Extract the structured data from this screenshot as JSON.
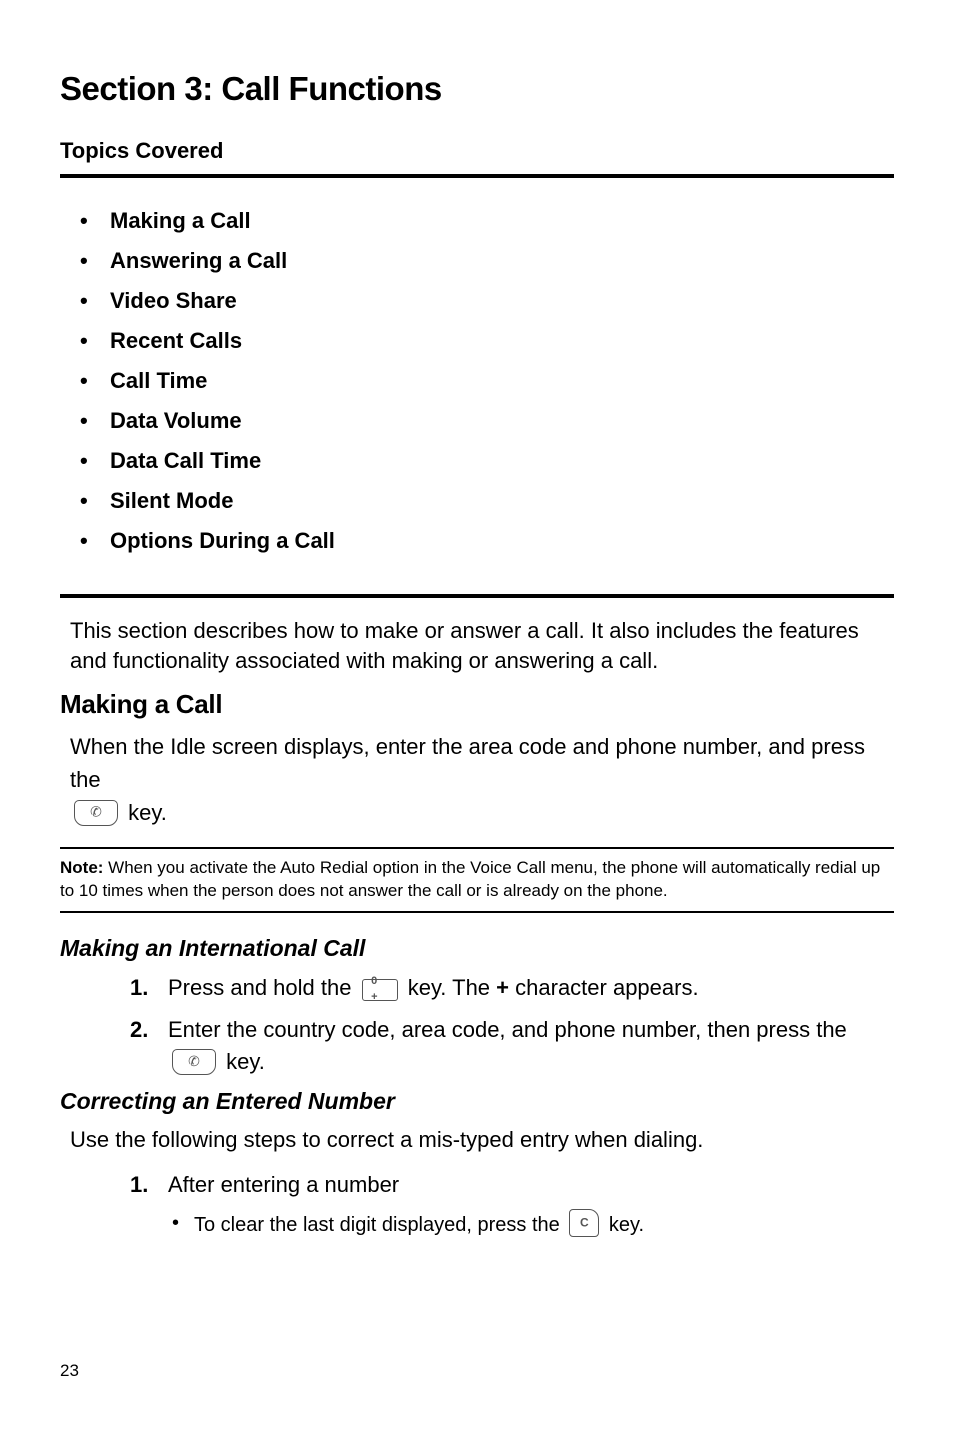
{
  "section_title": "Section 3:  Call Functions",
  "topics_header": "Topics Covered",
  "topics": [
    "Making a Call",
    "Answering a Call",
    "Video Share",
    "Recent Calls",
    "Call Time",
    "Data Volume",
    "Data Call Time",
    "Silent Mode",
    "Options During a Call"
  ],
  "intro_para": "This section describes how to make or answer a call. It also includes the features and functionality associated with making or answering a call.",
  "making_a_call_head": "Making a Call",
  "making_a_call_body_before": "When the Idle screen displays, enter the area code and phone number, and press the ",
  "making_a_call_body_after": " key.",
  "note_label": "Note:",
  "note_body": " When you activate the Auto Redial option in the Voice Call menu, the phone will automatically redial up to 10 times when the person does not answer the call or is already on the phone.",
  "intl_head": "Making an International Call",
  "intl_step1_pre": "Press and hold the ",
  "intl_step1_mid": " key. The ",
  "intl_step1_plus": "+",
  "intl_step1_post": " character appears.",
  "intl_step2_pre": "Enter the country code, area code, and phone number, then press the ",
  "intl_step2_post": " key.",
  "correcting_head": "Correcting an Entered Number",
  "correcting_body": "Use the following steps to correct a mis-typed entry when dialing.",
  "correcting_step1": "After entering a number",
  "correcting_sub_pre": "To clear the last digit displayed, press the ",
  "correcting_sub_post": " key.",
  "step_labels": {
    "one": "1.",
    "two": "2."
  },
  "page_number": "23",
  "keypad": {
    "zero_plus": "0 +",
    "c": "C"
  }
}
